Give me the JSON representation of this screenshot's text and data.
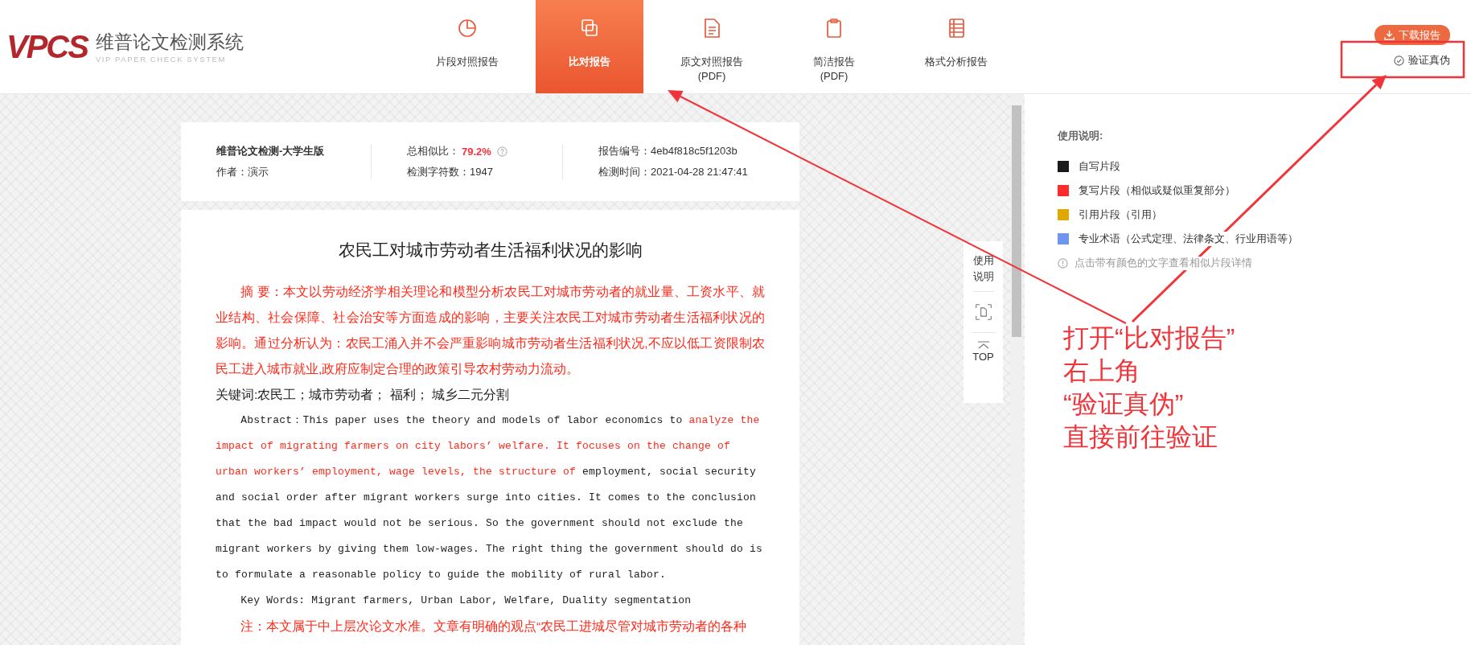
{
  "logo": {
    "mark": "VPCS",
    "name": "维普论文检测系统",
    "subtitle": "VIP PAPER CHECK SYSTEM"
  },
  "tabs": [
    {
      "label": "片段对照报告",
      "selected": false
    },
    {
      "label": "比对报告",
      "selected": true
    },
    {
      "label": "原文对照报告",
      "sublabel": "(PDF)",
      "selected": false
    },
    {
      "label": "简洁报告",
      "sublabel": "(PDF)",
      "selected": false
    },
    {
      "label": "格式分析报告",
      "selected": false
    }
  ],
  "actions": {
    "download": "下载报告",
    "verify": "验证真伪"
  },
  "info": {
    "edition": "维普论文检测-大学生版",
    "author": "作者：演示",
    "similarity_label": "总相似比：",
    "similarity_value": "79.2%",
    "char_count": "检测字符数：1947",
    "report_no": "报告编号：4eb4f818c5f1203b",
    "check_time": "检测时间：2021-04-28 21:47:41"
  },
  "document": {
    "title": "农民工对城市劳动者生活福利状况的影响",
    "paragraphs": [
      {
        "kind": "cn",
        "runs": [
          {
            "text": "摘 要：本文以劳动经济学相关理论和模型分析农民工对城市劳动者的就业量、工资水平、就业结构、社会保障、社会治安等方面造成的影响，主要关注农民工对城市劳动者生活福利状况的影响。通过分析认为：农民工涌入并不会严重影响城市劳动者生活福利状况,不应以低工资限制农民工进入城市就业,政府应制定合理的政策引导农村劳动力流动。",
            "kind": "similar"
          }
        ]
      },
      {
        "kind": "cn-plain",
        "runs": [
          {
            "text": "关键词:农民工；城市劳动者；  福利；  城乡二元分割",
            "kind": "own"
          }
        ]
      },
      {
        "kind": "en",
        "runs": [
          {
            "text": "Abstract：This paper uses the theory and models of labor economics to ",
            "kind": "own"
          },
          {
            "text": "analyze the impact of migrating farmers on city labors’ welfare. It focuses on the change of urban workers’ employment, wage levels, the structure of ",
            "kind": "similar"
          },
          {
            "text": "employment, social security and social order after migrant workers surge into cities. It comes to the conclusion that the bad impact would not be serious. So the government should not exclude the migrant workers by giving them low-wages. The right thing the government should do is to formulate a reasonable policy to guide the mobility of rural labor.",
            "kind": "own"
          }
        ]
      },
      {
        "kind": "en",
        "runs": [
          {
            "text": "Key Words: Migrant farmers, Urban Labor, Welfare, Duality segmentation",
            "kind": "own"
          }
        ]
      },
      {
        "kind": "cn",
        "runs": [
          {
            "text": "注：本文属于中上层次论文水准。文章有明确的观点“农民工进城尽管对城市劳动者的各种",
            "kind": "similar"
          }
        ]
      }
    ]
  },
  "tools": {
    "guide": "使用说明",
    "top": "TOP"
  },
  "legend": {
    "title": "使用说明:",
    "items": [
      {
        "label": "自写片段",
        "color": "#1a1a1a"
      },
      {
        "label": "复写片段（相似或疑似重复部分）",
        "color": "#ff2a2a"
      },
      {
        "label": "引用片段（引用）",
        "color": "#e0a800"
      },
      {
        "label": "专业术语（公式定理、法律条文、行业用语等）",
        "color": "#6f95f0"
      }
    ],
    "hint": "点击带有颜色的文字查看相似片段详情"
  },
  "callout": {
    "lines": [
      "打开“比对报告”",
      "右上角",
      "“验证真伪”",
      "直接前往验证"
    ]
  }
}
